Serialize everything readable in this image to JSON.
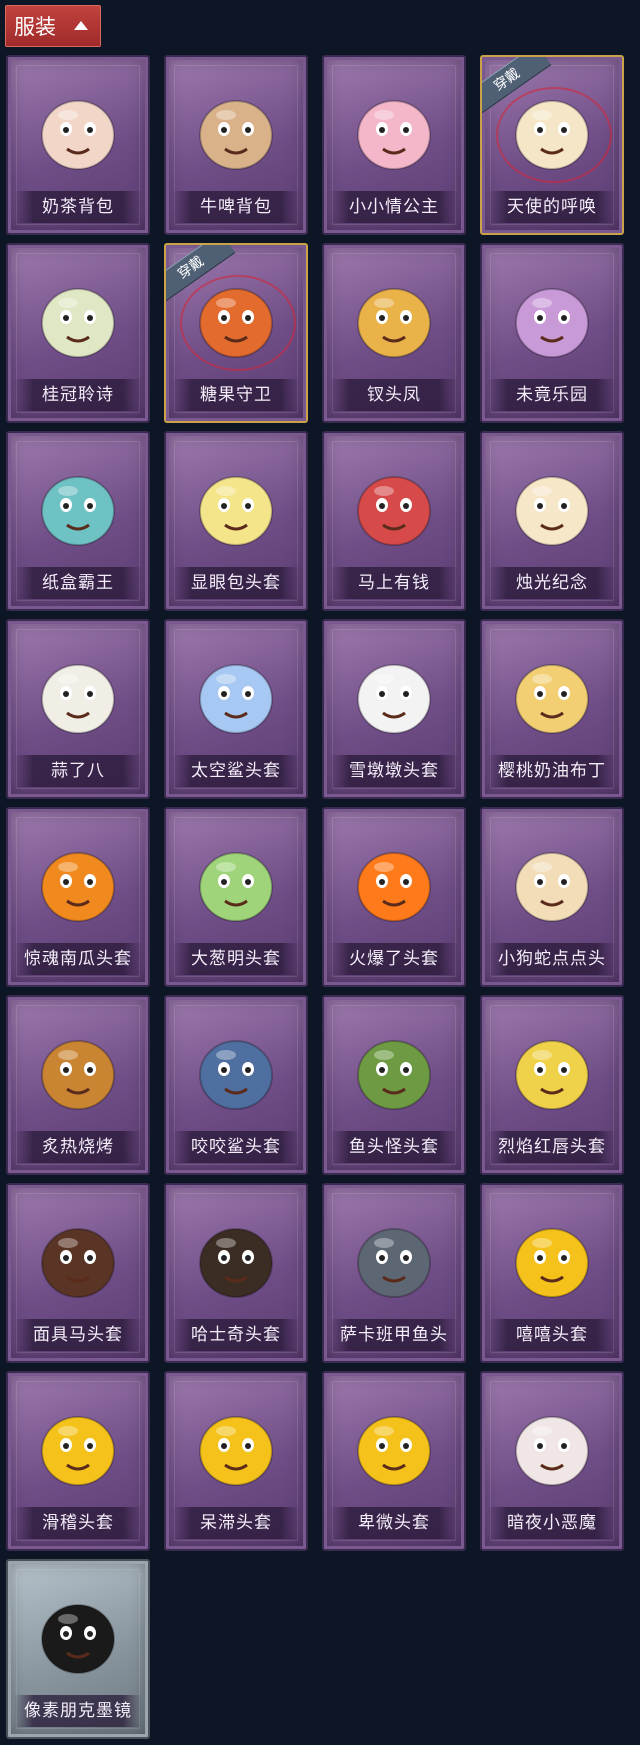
{
  "header": {
    "title": "服装"
  },
  "equipped_badge": "穿戴",
  "items": [
    {
      "label": "奶茶背包",
      "icon": "milk-tea-backpack-icon",
      "equipped": false
    },
    {
      "label": "牛啤背包",
      "icon": "cow-beer-backpack-icon",
      "equipped": false
    },
    {
      "label": "小小情公主",
      "icon": "little-princess-icon",
      "equipped": false
    },
    {
      "label": "天使的呼唤",
      "icon": "angel-call-icon",
      "equipped": true
    },
    {
      "label": "桂冠聆诗",
      "icon": "laurel-poem-icon",
      "equipped": false
    },
    {
      "label": "糖果守卫",
      "icon": "candy-guard-icon",
      "equipped": true
    },
    {
      "label": "钗头凤",
      "icon": "phoenix-hairpin-icon",
      "equipped": false
    },
    {
      "label": "未竟乐园",
      "icon": "unfinished-paradise-icon",
      "equipped": false
    },
    {
      "label": "纸盒霸王",
      "icon": "cardboard-dino-icon",
      "equipped": false
    },
    {
      "label": "显眼包头套",
      "icon": "light-bulb-head-icon",
      "equipped": false
    },
    {
      "label": "马上有钱",
      "icon": "lucky-horse-head-icon",
      "equipped": false
    },
    {
      "label": "烛光纪念",
      "icon": "candle-head-icon",
      "equipped": false
    },
    {
      "label": "蒜了八",
      "icon": "garlic-head-icon",
      "equipped": false
    },
    {
      "label": "太空鲨头套",
      "icon": "space-shark-head-icon",
      "equipped": false
    },
    {
      "label": "雪墩墩头套",
      "icon": "snowman-head-icon",
      "equipped": false
    },
    {
      "label": "樱桃奶油布丁",
      "icon": "cherry-pudding-head-icon",
      "equipped": false
    },
    {
      "label": "惊魂南瓜头套",
      "icon": "pumpkin-head-icon",
      "equipped": false
    },
    {
      "label": "大葱明头套",
      "icon": "scallion-head-icon",
      "equipped": false
    },
    {
      "label": "火爆了头套",
      "icon": "fire-head-icon",
      "equipped": false
    },
    {
      "label": "小狗蛇点点头",
      "icon": "dog-snake-head-icon",
      "equipped": false
    },
    {
      "label": "炙热烧烤",
      "icon": "bbq-head-icon",
      "equipped": false
    },
    {
      "label": "咬咬鲨头套",
      "icon": "biting-shark-head-icon",
      "equipped": false
    },
    {
      "label": "鱼头怪头套",
      "icon": "fish-head-icon",
      "equipped": false
    },
    {
      "label": "烈焰红唇头套",
      "icon": "red-lips-head-icon",
      "equipped": false
    },
    {
      "label": "面具马头套",
      "icon": "horse-mask-icon",
      "equipped": false
    },
    {
      "label": "哈士奇头套",
      "icon": "husky-head-icon",
      "equipped": false
    },
    {
      "label": "萨卡班甲鱼头",
      "icon": "sacabambaspis-head-icon",
      "equipped": false
    },
    {
      "label": "嘻嘻头套",
      "icon": "grin-emoji-head-icon",
      "equipped": false
    },
    {
      "label": "滑稽头套",
      "icon": "funny-emoji-head-icon",
      "equipped": false
    },
    {
      "label": "呆滞头套",
      "icon": "dazed-emoji-head-icon",
      "equipped": false
    },
    {
      "label": "卑微头套",
      "icon": "humble-emoji-head-icon",
      "equipped": false
    },
    {
      "label": "暗夜小恶魔",
      "icon": "night-devil-icon",
      "equipped": false
    },
    {
      "label": "像素朋克墨镜",
      "icon": "pixel-sunglasses-icon",
      "equipped": false,
      "silver": true
    }
  ]
}
